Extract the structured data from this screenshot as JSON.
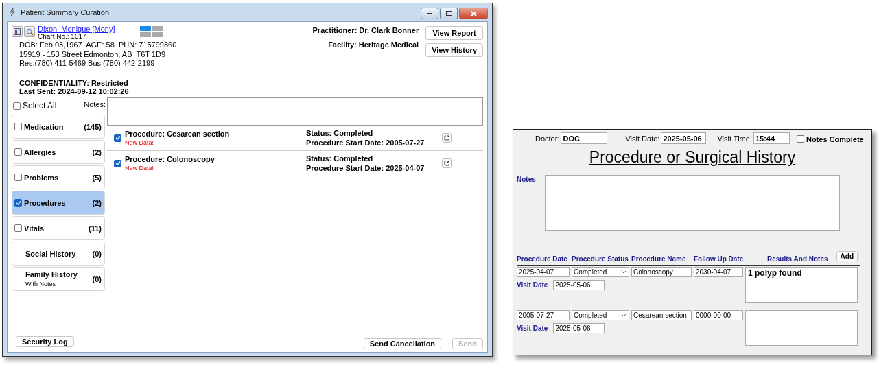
{
  "window": {
    "title": "Patient Summary Curation"
  },
  "patient": {
    "name": "Dixon, Monique [Mony]",
    "chart_no": "Chart No.: 1017",
    "details": [
      "DOB: Feb 03,1967  AGE: 58  PHN: 715799860",
      "15919 - 153 Street Edmonton, AB  T6T 1D9",
      "Res:(780) 411-5469 Bus:(780) 442-2199"
    ],
    "confidentiality": "CONFIDENTIALITY: Restricted",
    "last_sent": "Last Sent: 2024-09-12 10:02:26"
  },
  "practitioner": "Practitioner: Dr. Clark Bonner",
  "facility": "Facility: Heritage Medical",
  "header_buttons": [
    "View Report",
    "View History"
  ],
  "select_all": {
    "label": "Select All",
    "checked": false
  },
  "notes_label": "Notes:",
  "categories": [
    {
      "kind": "checkbox",
      "label": "Medication",
      "count": "(145)",
      "checked": false,
      "selected": false
    },
    {
      "kind": "checkbox",
      "label": "Allergies",
      "count": "(2)",
      "checked": false,
      "selected": false
    },
    {
      "kind": "checkbox",
      "label": "Problems",
      "count": "(5)",
      "checked": false,
      "selected": false
    },
    {
      "kind": "checkbox",
      "label": "Procedures",
      "count": "(2)",
      "checked": true,
      "selected": true
    },
    {
      "kind": "checkbox",
      "label": "Vitals",
      "count": "(11)",
      "checked": false,
      "selected": false
    },
    {
      "kind": "plain",
      "label": "Social History",
      "count": "(0)",
      "selected": false
    },
    {
      "kind": "plain",
      "label": "Family History",
      "count": "(0)",
      "note": "With Notes",
      "selected": false
    }
  ],
  "entries": [
    {
      "title": "Procedure: Cesarean section",
      "flag": "New Data!",
      "status": "Status: Completed",
      "start": "Procedure Start Date: 2005-07-27",
      "checked": true
    },
    {
      "title": "Procedure: Colonoscopy",
      "flag": "New Data!",
      "status": "Status: Completed",
      "start": "Procedure Start Date: 2025-04-07",
      "checked": true
    }
  ],
  "footer": {
    "security_log": "Security Log",
    "send_cancellation": "Send Cancellation",
    "send": {
      "label": "Send",
      "disabled": true
    }
  },
  "form": {
    "doctor": {
      "label": "Doctor:",
      "value": "DOC"
    },
    "visit_date": {
      "label": "Visit Date:",
      "value": "2025-05-06"
    },
    "visit_time": {
      "label": "Visit Time:",
      "value": "15:44"
    },
    "notes_complete": {
      "label": "Notes Complete",
      "checked": false
    },
    "title": "Procedure or Surgical History",
    "notes_label": "Notes",
    "columns": [
      "Procedure Date",
      "Procedure Status",
      "Procedure Name",
      "Follow Up Date",
      "Results And Notes"
    ],
    "add_button": "Add",
    "rows": [
      {
        "date": "2025-04-07",
        "status": "Completed",
        "name": "Colonoscopy",
        "follow_up": "2030-04-07",
        "results": "1 polyp found",
        "visit_date_label": "Visit Date",
        "visit_date": "2025-05-06"
      },
      {
        "date": "2005-07-27",
        "status": "Completed",
        "name": "Cesarean section",
        "follow_up": "0000-00-00",
        "visit_date_label": "Visit Date",
        "visit_date": "2025-05-06"
      }
    ]
  }
}
